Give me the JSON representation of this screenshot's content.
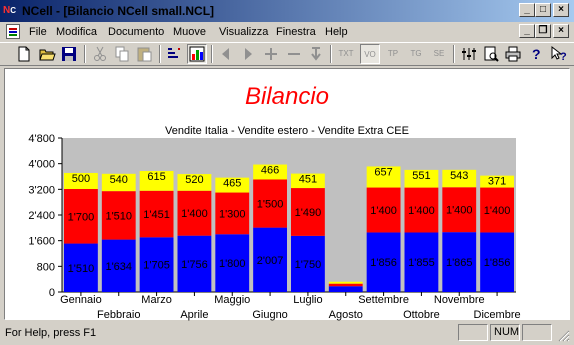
{
  "window": {
    "title": "NCell - [Bilancio NCell small.NCL]",
    "controls": [
      "_",
      "□",
      "×"
    ],
    "icon_n": "N",
    "icon_c": "C"
  },
  "menu": [
    "File",
    "Modifica",
    "Documento",
    "Muove",
    "Visualizza",
    "Finestra",
    "Help"
  ],
  "mdi_controls": [
    "_",
    "❐",
    "×"
  ],
  "toolbar": {
    "text_buttons": [
      "TXT",
      "VO",
      "TP",
      "TG",
      "SE"
    ]
  },
  "status": {
    "message": "For Help, press F1",
    "num": "NUM"
  },
  "colors": {
    "series1": "#0000ff",
    "series2": "#ff0000",
    "series3": "#ffff00",
    "plot_bg": "#c0c0c0",
    "title": "#ff0000"
  },
  "chart_data": {
    "type": "bar",
    "stacked": true,
    "title": "Bilancio",
    "subtitle": "Vendite Italia - Vendite estero - Vendite Extra CEE",
    "categories": [
      "Gennaio",
      "Febbraio",
      "Marzo",
      "Aprile",
      "Maggio",
      "Giugno",
      "Luglio",
      "Agosto",
      "Settembre",
      "Ottobre",
      "Novembre",
      "Dicembre"
    ],
    "series": [
      {
        "values": [
          1510,
          1634,
          1705,
          1756,
          1800,
          2007,
          1750,
          180,
          1856,
          1855,
          1865,
          1856
        ],
        "labels": [
          "1'510",
          "1'634",
          "1'705",
          "1'756",
          "1'800",
          "2'007",
          "1'750",
          "",
          "1'856",
          "1'855",
          "1'865",
          "1'856"
        ]
      },
      {
        "values": [
          1700,
          1510,
          1451,
          1400,
          1300,
          1500,
          1490,
          80,
          1400,
          1400,
          1400,
          1400
        ],
        "labels": [
          "1'700",
          "1'510",
          "1'451",
          "1'400",
          "1'300",
          "1'500",
          "1'490",
          "",
          "1'400",
          "1'400",
          "1'400",
          "1'400"
        ]
      },
      {
        "values": [
          500,
          540,
          615,
          520,
          465,
          466,
          451,
          60,
          657,
          551,
          543,
          371
        ],
        "labels": [
          "500",
          "540",
          "615",
          "520",
          "465",
          "466",
          "451",
          "",
          "657",
          "551",
          "543",
          "371"
        ]
      }
    ],
    "ylim": [
      0,
      4800
    ],
    "yticks": [
      0,
      800,
      1600,
      2400,
      3200,
      4000,
      4800
    ],
    "ytick_labels": [
      "0",
      "800",
      "1'600",
      "2'400",
      "3'200",
      "4'000",
      "4'800"
    ],
    "grid": false,
    "legend": "none"
  }
}
